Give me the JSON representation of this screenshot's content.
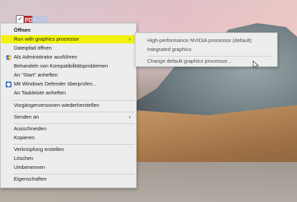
{
  "desktop": {
    "file_icon_text": "PDF",
    "file_icon_color": "#c9262a"
  },
  "context_menu": {
    "items": [
      {
        "label": "Öffnen",
        "bold": true
      },
      {
        "label": "Run with graphics processor",
        "highlight": true,
        "submenu": true
      },
      {
        "label": "Dateipfad öffnen"
      },
      {
        "label": "Als Administrator ausführen",
        "icon": "uac-shield-icon"
      },
      {
        "label": "Behandeln von Kompatibilitätsproblemen"
      },
      {
        "label": "An \"Start\" anheften"
      },
      {
        "label": "Mit Windows Defender überprüfen...",
        "icon": "windows-defender-icon"
      },
      {
        "label": "An Taskleiste anheften"
      },
      {
        "label": "Vorgängerversionen wiederherstellen"
      },
      {
        "label": "Senden an",
        "submenu": true
      },
      {
        "label": "Ausschneiden"
      },
      {
        "label": "Kopieren"
      },
      {
        "label": "Verknüpfung erstellen"
      },
      {
        "label": "Löschen"
      },
      {
        "label": "Umbenennen"
      },
      {
        "label": "Eigenschaften"
      }
    ],
    "highlight_color": "#f2f20a",
    "submenu_arrow": "›"
  },
  "submenu": {
    "items": [
      {
        "label": "High-performance NVIDIA processor (default)"
      },
      {
        "label": "Integrated graphics"
      },
      {
        "label": "Change default graphics processor..."
      }
    ]
  }
}
